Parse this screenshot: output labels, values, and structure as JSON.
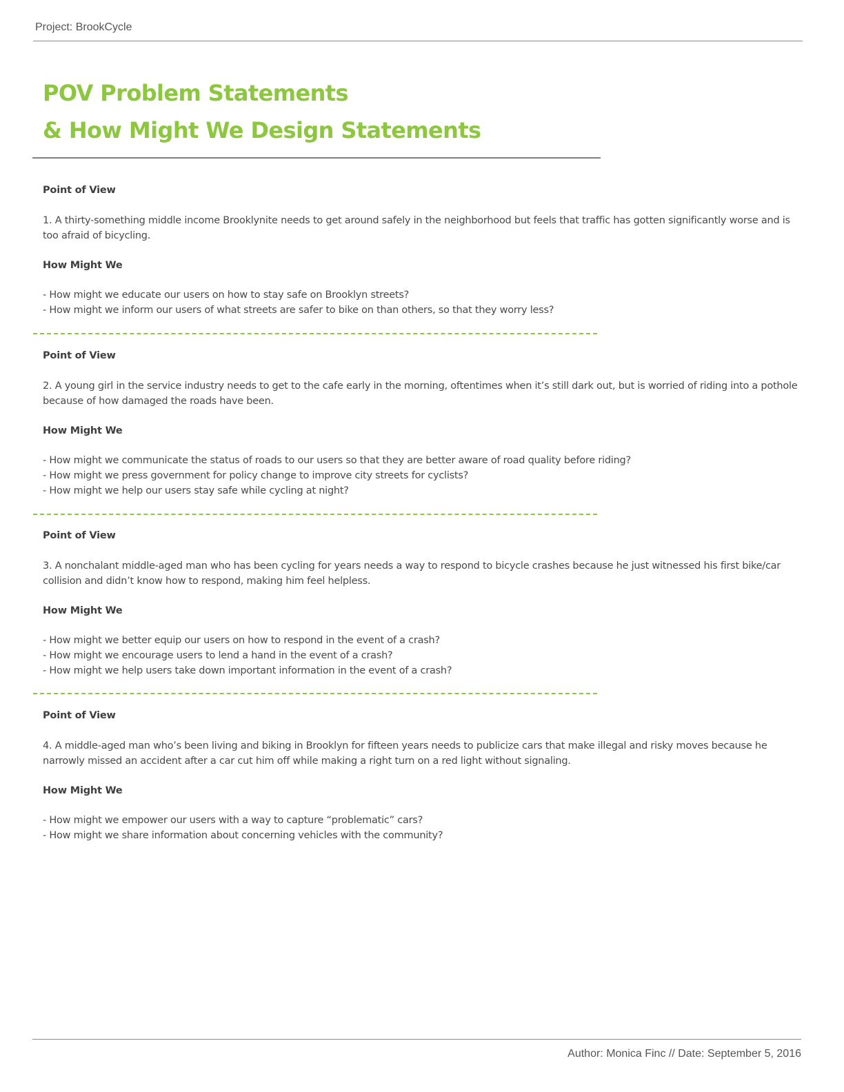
{
  "header": {
    "project": "Project: BrookCycle"
  },
  "title": {
    "line1": "POV Problem Statements",
    "line2": "& How Might We Design Statements"
  },
  "sections": [
    {
      "pov_label": "Point of View",
      "pov_text": "1. A thirty-something middle income Brooklynite needs to get around safely in the neighborhood but feels that traffic has gotten significantly worse and is too afraid of bicycling.",
      "hmw_label": "How Might We",
      "hmw_items": [
        "- How might we educate our users on how to stay safe on Brooklyn streets?",
        "- How might we inform our users of what streets are safer to bike on than others, so that they worry less?"
      ]
    },
    {
      "pov_label": "Point of View",
      "pov_text": "2. A young girl in the service industry needs to get to the cafe early in the morning, oftentimes when it’s still dark out, but is worried of riding into a pothole because of how damaged the roads have been.",
      "hmw_label": "How Might We",
      "hmw_items": [
        "- How might we communicate the status of roads to our users so that they are better aware of road quality before riding?",
        "- How might we press government for policy change to improve city streets for cyclists?",
        "- How might we help our users stay safe while cycling at night?"
      ]
    },
    {
      "pov_label": "Point of View",
      "pov_text": "3. A nonchalant middle-aged man who has been cycling for years needs a way to respond to bicycle crashes because he just witnessed his first bike/car collision and didn’t know how to respond, making him feel helpless.",
      "hmw_label": "How Might We",
      "hmw_items": [
        "- How might we better equip our users on how to respond in the event of a crash?",
        "- How might we encourage users to lend a hand in the event of a crash?",
        "- How might we help users take down important information in the event of a crash?"
      ]
    },
    {
      "pov_label": "Point of View",
      "pov_text": "4. A middle-aged man who’s been living and biking in Brooklyn for fifteen years needs to publicize cars that make illegal and risky moves because he narrowly missed an accident after a car cut him off while making a right turn on a red light without signaling.",
      "hmw_label": "How Might We",
      "hmw_items": [
        "- How might we empower our users with a way to capture “problematic” cars?",
        "- How might we share information about concerning vehicles with the community?"
      ]
    }
  ],
  "footer": {
    "text": "Author: Monica Finc  //  Date: September 5, 2016"
  },
  "colors": {
    "accent": "#8dc63f",
    "text": "#4a4a4a",
    "rule": "#8a8a8a"
  }
}
